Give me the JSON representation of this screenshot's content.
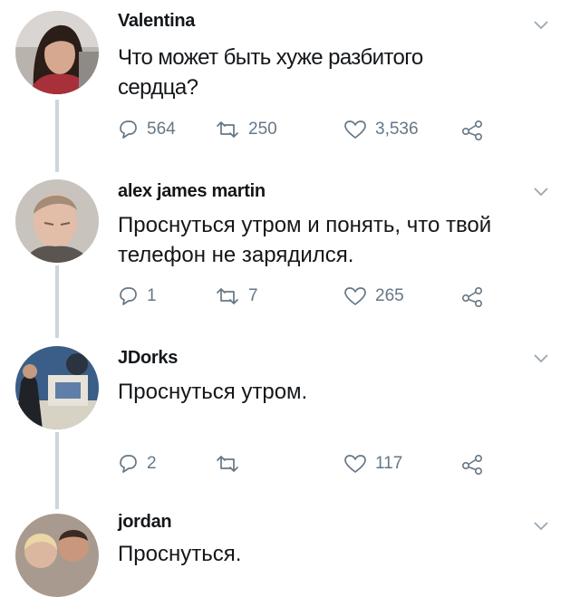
{
  "tweets": [
    {
      "name": "Valentina",
      "text": "Что может быть хуже разбитого сердца?",
      "replies": "564",
      "retweets": "250",
      "likes": "3,536"
    },
    {
      "name": "alex james martin",
      "text": "Проснуться утром и понять, что твой телефон не зарядился.",
      "replies": "1",
      "retweets": "7",
      "likes": "265"
    },
    {
      "name": "JDorks",
      "text": "Проснуться утром.",
      "replies": "2",
      "retweets": "",
      "likes": "117"
    },
    {
      "name": "jordan",
      "text": "Проснуться."
    }
  ],
  "icons": {
    "reply": "reply-icon",
    "retweet": "retweet-icon",
    "like": "heart-icon",
    "share": "share-icon",
    "more": "chevron-down-icon"
  },
  "colors": {
    "icon_gray": "#657786",
    "thread_line": "#ccd6dd",
    "text": "#14171a"
  }
}
